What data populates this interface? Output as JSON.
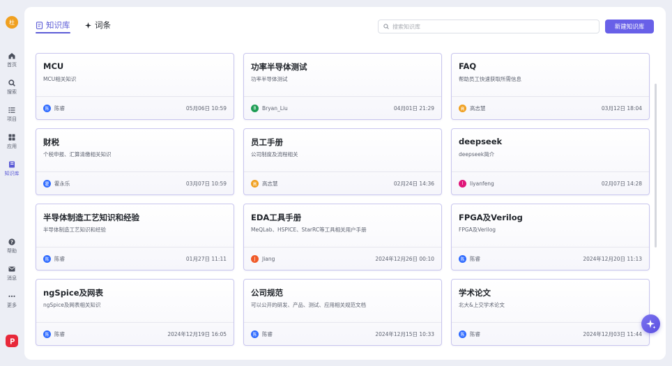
{
  "user": {
    "avatar_text": "杜",
    "avatar_color": "#f0a020"
  },
  "sidebar": {
    "items": [
      {
        "label": "首页",
        "icon": "home-icon"
      },
      {
        "label": "搜索",
        "icon": "search-icon"
      },
      {
        "label": "项目",
        "icon": "list-icon"
      },
      {
        "label": "应用",
        "icon": "grid-icon"
      },
      {
        "label": "知识库",
        "icon": "book-icon",
        "active": true
      }
    ],
    "bottom_items": [
      {
        "label": "帮助",
        "icon": "help-icon"
      },
      {
        "label": "消息",
        "icon": "mail-icon"
      },
      {
        "label": "更多",
        "icon": "more-icon"
      }
    ],
    "accent": "#5b5bd6"
  },
  "header": {
    "tabs": [
      {
        "label": "知识库",
        "icon": "document-icon",
        "active": true
      },
      {
        "label": "词条",
        "icon": "sparkle-icon"
      }
    ],
    "search_placeholder": "搜索知识库",
    "new_button_label": "新建知识库"
  },
  "cards": [
    {
      "title": "MCU",
      "desc": "MCU相关知识",
      "author": "陈睿",
      "avatar": "陈",
      "avatar_color": "#2f6bff",
      "time": "05月06日 10:59"
    },
    {
      "title": "功率半导体测试",
      "desc": "功率半导体测试",
      "author": "Bryan_Liu",
      "avatar": "B",
      "avatar_color": "#1f9d55",
      "time": "04月01日 21:29"
    },
    {
      "title": "FAQ",
      "desc": "帮助员工快速获取所需信息",
      "author": "高志慧",
      "avatar": "高",
      "avatar_color": "#f0a020",
      "time": "03月12日 18:04"
    },
    {
      "title": "财税",
      "desc": "个税申报、汇算清缴相关知识",
      "author": "霍永乐",
      "avatar": "霍",
      "avatar_color": "#2f6bff",
      "time": "03月07日 10:59"
    },
    {
      "title": "员工手册",
      "desc": "公司制度及流程相关",
      "author": "高志慧",
      "avatar": "高",
      "avatar_color": "#f0a020",
      "time": "02月24日 14:36"
    },
    {
      "title": "deepseek",
      "desc": "deepseek简介",
      "author": "liyanfeng",
      "avatar": "l",
      "avatar_color": "#e0177a",
      "time": "02月07日 14:28"
    },
    {
      "title": "半导体制造工艺知识和经验",
      "desc": "半导体制造工艺知识和经验",
      "author": "陈睿",
      "avatar": "陈",
      "avatar_color": "#2f6bff",
      "time": "01月27日 11:11"
    },
    {
      "title": "EDA工具手册",
      "desc": "MeQLab、HSPICE、StarRC等工具相关用户手册",
      "author": "Jiang",
      "avatar": "J",
      "avatar_color": "#f05a28",
      "time": "2024年12月26日 00:10"
    },
    {
      "title": "FPGA及Verilog",
      "desc": "FPGA及Verilog",
      "author": "陈睿",
      "avatar": "陈",
      "avatar_color": "#2f6bff",
      "time": "2024年12月20日 11:13"
    },
    {
      "title": "ngSpice及网表",
      "desc": "ngSpice及网表相关知识",
      "author": "陈睿",
      "avatar": "陈",
      "avatar_color": "#2f6bff",
      "time": "2024年12月19日 16:05"
    },
    {
      "title": "公司规范",
      "desc": "可以公开的研发、产品、测试、应用相关规范文档",
      "author": "陈睿",
      "avatar": "陈",
      "avatar_color": "#2f6bff",
      "time": "2024年12月15日 10:33"
    },
    {
      "title": "学术论文",
      "desc": "北大&上交学术论文",
      "author": "陈睿",
      "avatar": "陈",
      "avatar_color": "#2f6bff",
      "time": "2024年12月03日 11:44"
    }
  ]
}
